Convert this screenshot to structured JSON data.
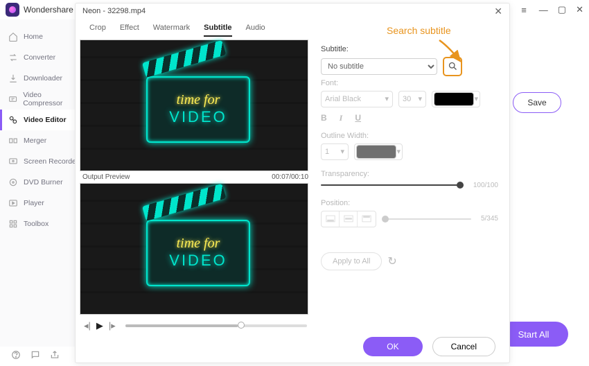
{
  "titlebar": {
    "brand": "Wondershare"
  },
  "sidebar": {
    "items": [
      {
        "label": "Home"
      },
      {
        "label": "Converter"
      },
      {
        "label": "Downloader"
      },
      {
        "label": "Video Compressor"
      },
      {
        "label": "Video Editor"
      },
      {
        "label": "Merger"
      },
      {
        "label": "Screen Recorder"
      },
      {
        "label": "DVD Burner"
      },
      {
        "label": "Player"
      },
      {
        "label": "Toolbox"
      }
    ]
  },
  "rightpanel": {
    "save_label": "Save",
    "startall_label": "Start All"
  },
  "dialog": {
    "title": "Neon - 32298.mp4",
    "tabs": {
      "crop": "Crop",
      "effect": "Effect",
      "watermark": "Watermark",
      "subtitle": "Subtitle",
      "audio": "Audio"
    },
    "preview": {
      "output_label": "Output Preview",
      "timecode": "00:07/00:10",
      "neon_line1": "time for",
      "neon_line2": "VIDEO"
    },
    "subtitle": {
      "label": "Subtitle:",
      "value": "No subtitle",
      "font_label": "Font:",
      "font_value": "Arial Black",
      "font_size": "30",
      "outline_label": "Outline Width:",
      "outline_value": "1",
      "transparency_label": "Transparency:",
      "transparency_value": "100/100",
      "position_label": "Position:",
      "position_value": "5/345",
      "apply_label": "Apply to All"
    },
    "footer": {
      "ok": "OK",
      "cancel": "Cancel"
    }
  },
  "annotation": {
    "text": "Search subtitle"
  },
  "colors": {
    "accent": "#8b5cf6",
    "highlight": "#e8941e",
    "swatch_font": "#000000",
    "swatch_outline": "#707070"
  }
}
